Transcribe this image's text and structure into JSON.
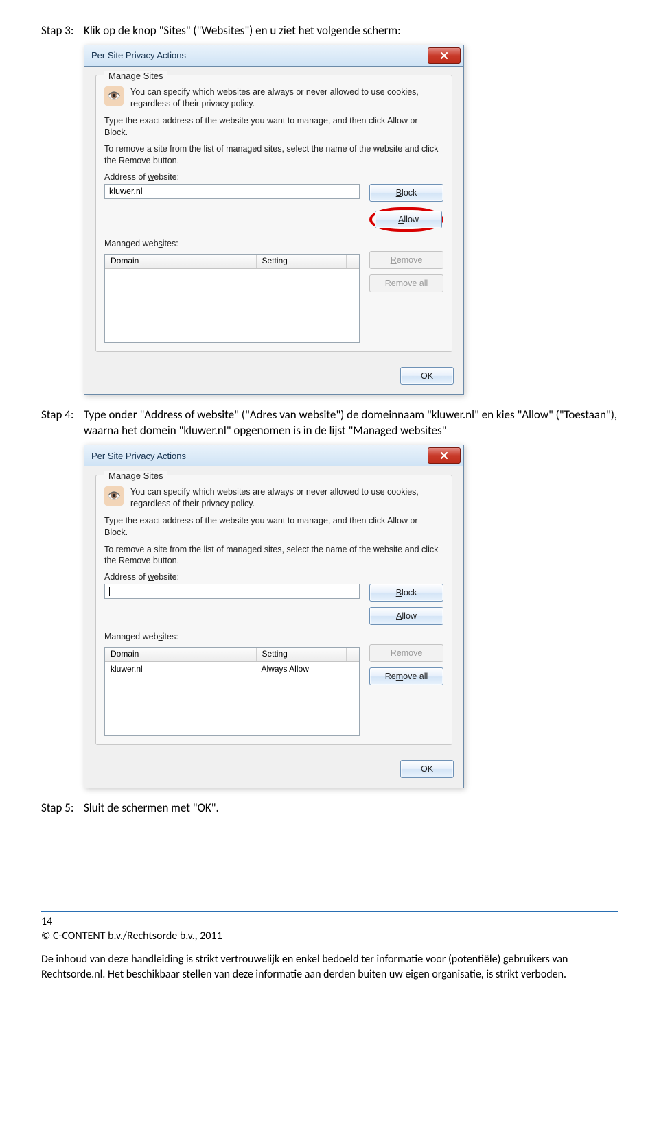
{
  "step3": {
    "label": "Stap 3:",
    "text": "Klik op de knop \"Sites\" (\"Websites\") en u ziet het volgende scherm:"
  },
  "step4": {
    "label": "Stap 4:",
    "text": "Type onder \"Address of website\" (\"Adres van website\") de domeinnaam \"kluwer.nl\" en kies \"Allow\" (\"Toestaan\"), waarna het domein \"kluwer.nl\" opgenomen is in de lijst \"Managed websites\""
  },
  "step5": {
    "label": "Stap 5:",
    "text": "Sluit de schermen met \"OK\"."
  },
  "dialog": {
    "title": "Per Site Privacy Actions",
    "group_legend": "Manage Sites",
    "help_text": "You can specify which websites are always or never allowed to use cookies, regardless of their privacy policy.",
    "body1": "Type the exact address of the website you want to manage, and then click Allow or Block.",
    "body2": "To remove a site from the list of managed sites, select the name of the website and click the Remove button.",
    "address_label_pre": "Address of ",
    "address_label_u": "w",
    "address_label_post": "ebsite:",
    "address_value_1": "kluwer.nl",
    "address_value_2": "",
    "block_u": "B",
    "block_rest": "lock",
    "allow_u": "A",
    "allow_rest": "llow",
    "managed_label_pre": "Managed web",
    "managed_label_u": "s",
    "managed_label_post": "ites:",
    "col_domain": "Domain",
    "col_setting": "Setting",
    "remove_u": "R",
    "remove_rest": "emove",
    "removeall_pre": "Re",
    "removeall_u": "m",
    "removeall_post": "ove all",
    "ok": "OK",
    "row_domain": "kluwer.nl",
    "row_setting": "Always Allow"
  },
  "footer": {
    "page": "14",
    "copyright": "© C-CONTENT b.v./Rechtsorde b.v., 2011",
    "disclaimer": "De inhoud van deze handleiding is strikt vertrouwelijk en enkel bedoeld ter informatie voor (potentiële) gebruikers van Rechtsorde.nl. Het beschikbaar stellen van deze informatie aan derden buiten uw eigen organisatie, is strikt verboden."
  }
}
